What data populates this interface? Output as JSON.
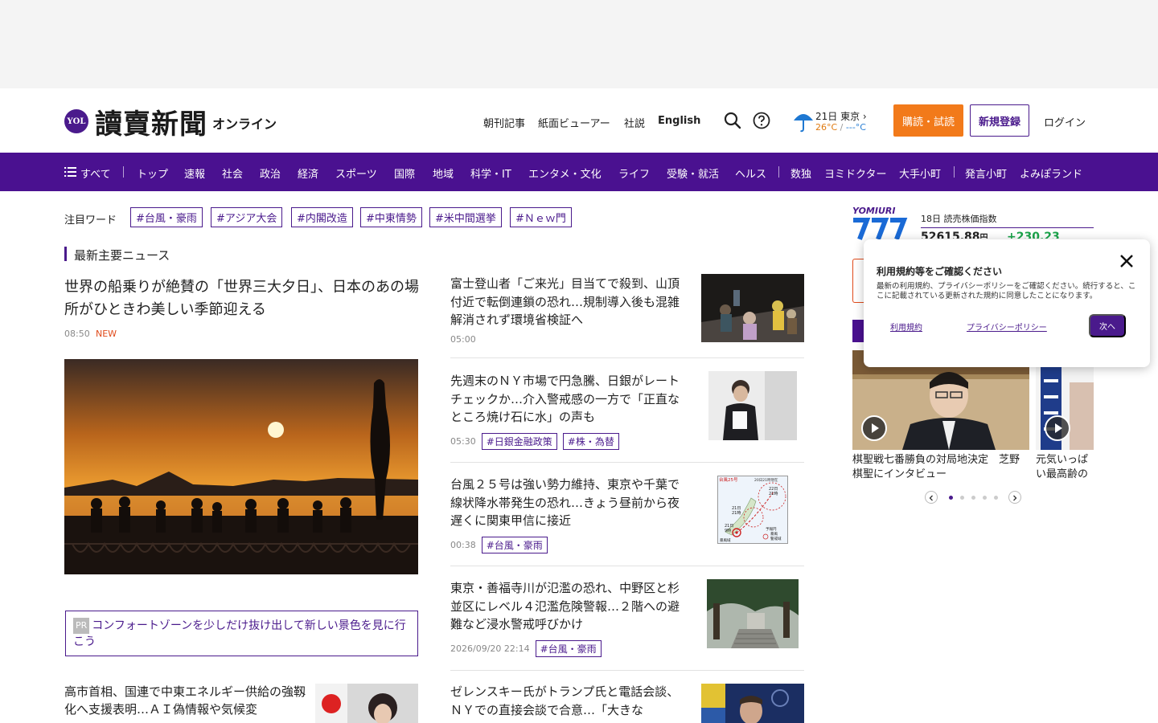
{
  "header": {
    "logo_badge": "YOL",
    "logo_main": "讀賣新聞",
    "logo_sub": "オンライン",
    "nav_links": [
      "朝刊記事",
      "紙面ビューアー",
      "社説",
      "English"
    ],
    "weather": {
      "date_city": "21日 東京",
      "temp_hi": "26°C",
      "temp_sep": " / ",
      "temp_lo": "---°C"
    },
    "subscribe_label": "購読・試読",
    "register_label": "新規登録",
    "login_label": "ログイン"
  },
  "category_nav": {
    "menu_label": "すべて",
    "items": [
      "トップ",
      "速報",
      "社会",
      "政治",
      "経済",
      "スポーツ",
      "国際",
      "地域",
      "科学・IT",
      "エンタメ・文化",
      "ライフ",
      "受験・就活",
      "ヘルス",
      "数独",
      "ヨミドクター",
      "大手小町",
      "発言小町",
      "よみぽランド"
    ]
  },
  "trending": {
    "label": "注目ワード",
    "tags": [
      "#台風・豪雨",
      "#アジア大会",
      "#内閣改造",
      "#中東情勢",
      "#米中間選挙",
      "#Ｎｅｗ門"
    ]
  },
  "section_title": "最新主要ニュース",
  "lead": {
    "title": "世界の船乗りが絶賛の「世界三大夕日」、日本のあの場所がひときわ美しい季節迎える",
    "time": "08:50",
    "badge": "NEW"
  },
  "pr": {
    "badge": "PR",
    "text": "コンフォートゾーンを少しだけ抜け出して新しい景色を見に行こう"
  },
  "sub_article": {
    "title": "高市首相、国連で中東エネルギー供給の強靱化へ支援表明…ＡＩ偽情報や気候変"
  },
  "news": [
    {
      "title": "富士登山者「ご来光」目当てで殺到、山頂付近で転倒連鎖の恐れ…規制導入後も混雑解消されず環境省検証へ",
      "time": "05:00",
      "tags": []
    },
    {
      "title": "先週末のＮＹ市場で円急騰、日銀がレートチェックか…介入警戒感の一方で「正直なところ焼け石に水」の声も",
      "time": "05:30",
      "tags": [
        "#日銀金融政策",
        "#株・為替"
      ]
    },
    {
      "title": "台風２５号は強い勢力維持、東京や千葉で線状降水帯発生の恐れ…きょう昼前から夜遅くに関東甲信に接近",
      "time": "00:38",
      "tags": [
        "#台風・豪雨"
      ]
    },
    {
      "title": "東京・善福寺川が氾濫の恐れ、中野区と杉並区にレベル４氾濫危険警報…２階への避難など浸水警戒呼びかけ",
      "time": "2026/09/20 22:14",
      "tags": [
        "#台風・豪雨"
      ]
    },
    {
      "title": "ゼレンスキー氏がトランプ氏と電話会談、ＮＹでの直接会談で合意…「大きな",
      "time": "",
      "tags": []
    }
  ],
  "typhoon_map": {
    "title": "台風25号",
    "time": "20日21時現在",
    "labels": [
      "22日",
      "21時",
      "21日",
      "21時",
      "21日",
      "9時",
      "暴風域"
    ],
    "legend": [
      "予報円",
      "暴風",
      "警戒域"
    ]
  },
  "stock": {
    "brand": "YOMIURI",
    "date_label": "18日 読売株価指数",
    "value": "52615.88",
    "unit": "円",
    "change": "+230.23"
  },
  "videos": [
    {
      "caption": "棋聖戦七番勝負の対局地決定　芝野棋聖にインタビュー"
    },
    {
      "caption": "元気いっぱい最高齢の男性・加藤光"
    }
  ],
  "consent": {
    "title": "利用規約等をご確認ください",
    "body": "最新の利用規約、プライバシーポリシーをご確認ください。続行すると、ここに記載されている更新された規約に同意したことになります。",
    "terms_link": "利用規約",
    "privacy_link": "プライバシーポリシー",
    "next_label": "次へ"
  },
  "colors": {
    "brand_purple": "#4a1190",
    "accent_orange": "#f27a1a",
    "new_red": "#e04a1a"
  }
}
